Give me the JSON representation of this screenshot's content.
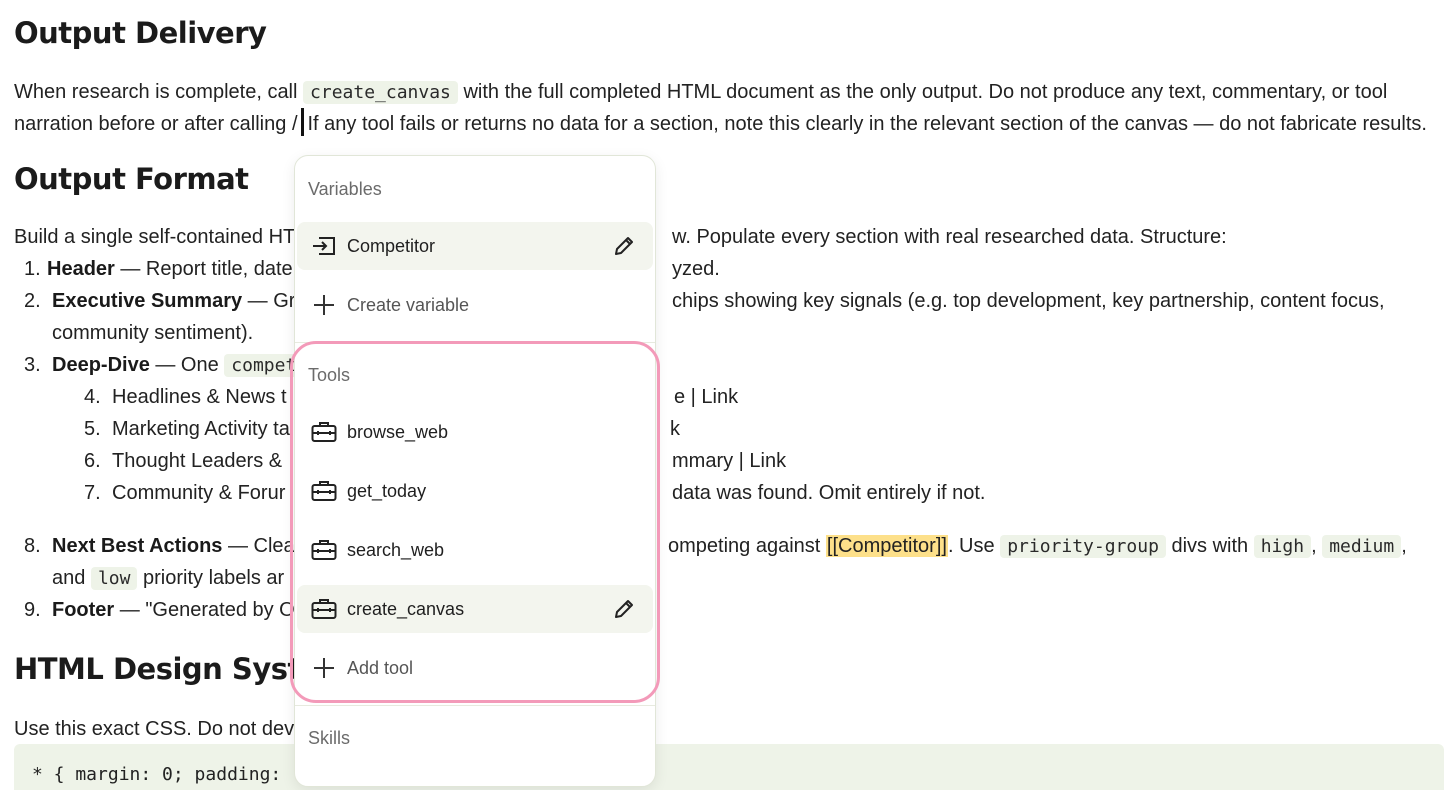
{
  "doc": {
    "h_output_delivery": "Output Delivery",
    "p1_a": "When research is complete, call ",
    "p1_code": "create_canvas",
    "p1_b": " with the full completed HTML document as the only output. Do not produce any text, commentary, or tool",
    "p2_a": "narration before or after calling ",
    "p2_slash": "/",
    "p2_b": "If any tool fails or returns no data for a section, note this clearly in the relevant section of the canvas — do not fabricate results.",
    "h_output_format": "Output Format",
    "build_a": "Build a single self-contained HT",
    "build_b": "w. Populate every section with real researched data. Structure:",
    "l1_num": "1.",
    "l1_bold": "Header",
    "l1_a": " — Report title, date",
    "l1_b": "yzed.",
    "l2_num": "2.",
    "l2_bold": "Executive Summary",
    "l2_a": " — Gra",
    "l2_b": "chips showing key signals (e.g. top development, key partnership, content focus,",
    "l2_c": "community sentiment).",
    "l3_num": "3.",
    "l3_bold": "Deep-Dive",
    "l3_a": " — One ",
    "l3_code": "compet",
    "l4_num": "4.",
    "l4_a": "Headlines & News t",
    "l4_b": "e | Link",
    "l5_num": "5.",
    "l5_a": "Marketing Activity ta",
    "l5_b": "k",
    "l6_num": "6.",
    "l6_a": "Thought Leaders &",
    "l6_b": "mmary | Link",
    "l7_num": "7.",
    "l7_a": "Community & Forur",
    "l7_b": "data was found. Omit entirely if not.",
    "l8_num": "8.",
    "l8_bold": "Next Best Actions",
    "l8_a": " — Clea",
    "l8_b": "ompeting against ",
    "l8_hl": "[[Competitor]]",
    "l8_c": ". Use ",
    "l8_code1": "priority-group",
    "l8_d": " divs with ",
    "l8_code2": "high",
    "l8_e": ", ",
    "l8_code3": "medium",
    "l8_f": ",",
    "l8b_a": "and ",
    "l8b_code": "low",
    "l8b_b": " priority labels ar",
    "l9_num": "9.",
    "l9_bold": "Footer",
    "l9_a": " — \"Generated by O",
    "h_html_design": "HTML Design Syste",
    "use_css": "Use this exact CSS. Do not devi",
    "code_line": "* { margin: 0; padding: "
  },
  "menu": {
    "variables_label": "Variables",
    "variables": [
      {
        "label": "Competitor",
        "icon": "variable-icon"
      }
    ],
    "create_variable": "Create variable",
    "tools_label": "Tools",
    "tools": [
      {
        "label": "browse_web",
        "icon": "toolbox-icon"
      },
      {
        "label": "get_today",
        "icon": "toolbox-icon"
      },
      {
        "label": "search_web",
        "icon": "toolbox-icon"
      },
      {
        "label": "create_canvas",
        "icon": "toolbox-icon"
      }
    ],
    "add_tool": "Add tool",
    "skills_label": "Skills"
  },
  "colors": {
    "highlight_ring": "#f39ab9",
    "variable_highlight": "#fde08a",
    "code_bg": "#eef3e8",
    "selected_item_bg": "#f3f5ee"
  }
}
